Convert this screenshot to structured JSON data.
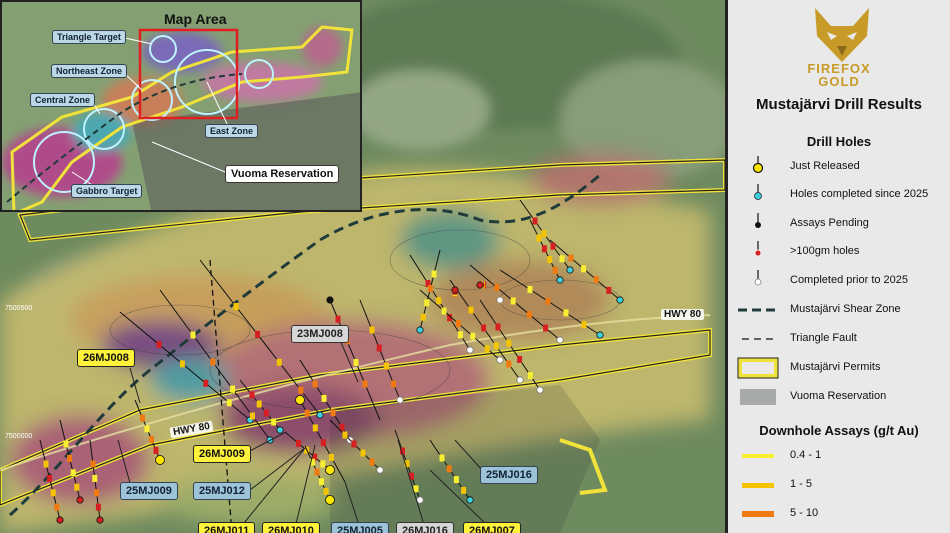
{
  "inset": {
    "title": "Map Area",
    "labels": {
      "triangle_target": "Triangle Target",
      "northeast_zone": "Northeast Zone",
      "central_zone": "Central Zone",
      "east_zone": "East Zone",
      "gabbro_target": "Gabbro Target",
      "vuoma_reservation": "Vuoma Reservation"
    }
  },
  "map": {
    "highway_labels": [
      "HWY 80",
      "HWY 80"
    ],
    "grid_labels": [
      "7500500",
      "7500000"
    ],
    "hole_callouts": [
      {
        "id": "26MJ008",
        "style": "yellow"
      },
      {
        "id": "23MJ008",
        "style": "grey"
      },
      {
        "id": "26MJ009",
        "style": "yellow"
      },
      {
        "id": "25MJ009",
        "style": "blue"
      },
      {
        "id": "25MJ012",
        "style": "blue"
      },
      {
        "id": "25MJ016",
        "style": "blue"
      },
      {
        "id": "26MJ011",
        "style": "yellow"
      },
      {
        "id": "26MJ010",
        "style": "yellow"
      },
      {
        "id": "25MJ005",
        "style": "blue"
      },
      {
        "id": "26MJ016",
        "style": "grey"
      },
      {
        "id": "26MJ007",
        "style": "yellow"
      }
    ]
  },
  "legend": {
    "brand_line1": "FIREFOX",
    "brand_line2": "GOLD",
    "title": "Mustajärvi Drill Results",
    "drill_holes_heading": "Drill Holes",
    "drill_items": [
      {
        "label": "Just Released",
        "symbol": "yellow-collar"
      },
      {
        "label": "Holes completed since 2025",
        "symbol": "cyan-collar"
      },
      {
        "label": "Assays Pending",
        "symbol": "black-collar"
      },
      {
        "label": ">100gm holes",
        "symbol": "red-collar"
      },
      {
        "label": "Completed prior to 2025",
        "symbol": "white-collar"
      }
    ],
    "line_items": [
      {
        "label": "Mustajärvi Shear Zone",
        "symbol": "thick-dash"
      },
      {
        "label": "Triangle Fault",
        "symbol": "thin-dash"
      },
      {
        "label": "Mustajärvi Permits",
        "symbol": "permit-box"
      },
      {
        "label": "Vuoma Reservation",
        "symbol": "grey-box"
      }
    ],
    "assays_heading": "Downhole Assays (g/t Au)",
    "assay_items": [
      {
        "label": "0.4 - 1",
        "color": "#f7ef2f"
      },
      {
        "label": "1 - 5",
        "color": "#f5c400"
      },
      {
        "label": "5 - 10",
        "color": "#f07a10"
      }
    ]
  },
  "colors": {
    "permit_outline": "#f0e23a",
    "shear_zone": "#1f3b3a",
    "collar_yellow": "#ffe600",
    "collar_cyan": "#3fd0e0",
    "collar_red": "#d42020",
    "brand_gold": "#c89a28"
  }
}
